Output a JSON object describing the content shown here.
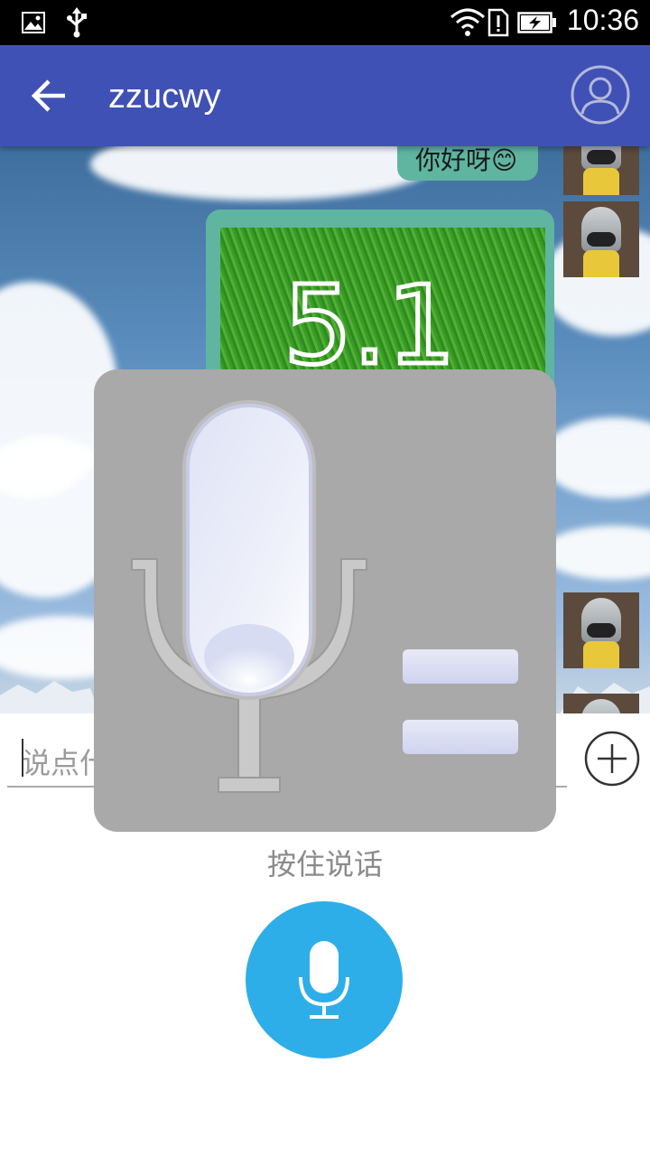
{
  "status_bar": {
    "time": "10:36",
    "icons": [
      "image-icon",
      "usb-icon",
      "wifi-icon",
      "sim-alert-icon",
      "battery-charging-icon"
    ]
  },
  "app_bar": {
    "title": "zzucwy",
    "back_icon": "arrow-back-icon",
    "profile_icon": "user-profile-icon",
    "color": "#3f51b5"
  },
  "chat": {
    "messages": [
      {
        "type": "text",
        "text": "你好呀😊"
      },
      {
        "type": "image",
        "content": "5.1"
      }
    ],
    "bubble_color": "#5fb5a0"
  },
  "input": {
    "placeholder": "说点什么"
  },
  "voice": {
    "hold_label": "按住说话",
    "button_color": "#2eaee8"
  }
}
